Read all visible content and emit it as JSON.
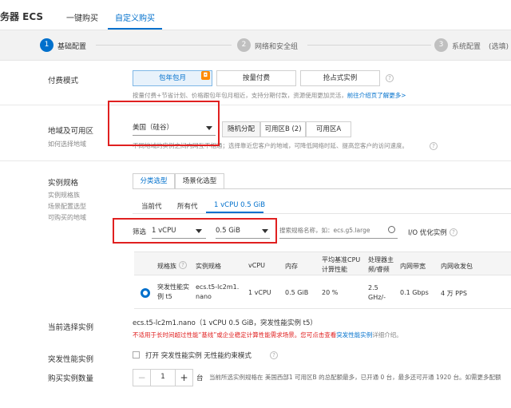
{
  "header": {
    "brand": "务器 ECS",
    "tabs": [
      {
        "label": "一键购买"
      },
      {
        "label": "自定义购买"
      }
    ]
  },
  "steps": [
    {
      "num": "1",
      "label": "基础配置"
    },
    {
      "num": "2",
      "label": "网络和安全组"
    },
    {
      "num": "3",
      "label": "系统配置"
    },
    {
      "extra": "(选填)"
    }
  ],
  "billing": {
    "label": "付费模式",
    "options": [
      "包年包月",
      "按量付费",
      "抢占式实例"
    ],
    "hint": "按量付费+节省计划、价格跟包年包月相近，支持分期付款，资源使用更加灵活，",
    "hint_link": "前往介绍页了解更多>"
  },
  "region": {
    "label": "地域及可用区",
    "sub": "如何选择地域",
    "selected": "美国（硅谷）",
    "zones": [
      "随机分配",
      "可用区B (2)",
      "可用区A"
    ],
    "hint": "不同地域的实例之间内网互不相通；选择靠近您客户的地域，可降低网络时延、提高您客户的访问速度。"
  },
  "instance": {
    "label": "实例规格",
    "subs": [
      "实例规格族",
      "场景配置选型",
      "可购买的地域"
    ],
    "tabs": [
      "分类选型",
      "场景化选型"
    ],
    "gen_tabs": [
      "当前代",
      "所有代",
      "1 vCPU 0.5 GiB"
    ],
    "filter_label": "筛选",
    "cpu_value": "1 vCPU",
    "mem_value": "0.5 GiB",
    "search_placeholder": "搜索规格名称，如：ecs.g5.large",
    "io_label": "I/O 优化实例"
  },
  "table": {
    "headers": [
      "规格族",
      "实例规格",
      "vCPU",
      "内存",
      "平均基准CPU计算性能",
      "处理器主频/睿频",
      "内网带宽",
      "内网收发包"
    ],
    "row": {
      "family": "突发性能实例 t5",
      "spec": "ecs.t5-lc2m1.nano",
      "vcpu": "1 vCPU",
      "mem": "0.5 GiB",
      "perf": "20 %",
      "freq": "2.5 GHz/-",
      "bandwidth": "0.1 Gbps",
      "pps": "4 万 PPS"
    }
  },
  "current": {
    "label": "当前选择实例",
    "value": "ecs.t5-lc2m1.nano（1 vCPU 0.5 GiB，突发性能实例 t5）",
    "warn": "不适用于长时间超过性能“基线”或企业稳定计算性能需求场景。您可点击查看",
    "warn_link": "突发性能实例",
    "warn_tail": "详细介绍。"
  },
  "burst": {
    "label": "突发性能实例",
    "checkbox_label": "打开 突发性能实例 无性能约束模式"
  },
  "quantity": {
    "label": "购买实例数量",
    "value": "1",
    "unit": "台",
    "hint": "当前所选实例规格在 美国西部1 可用区B 的总配额最多，已开通 0 台，最多还可开通 1920 台。如需更多配额"
  }
}
